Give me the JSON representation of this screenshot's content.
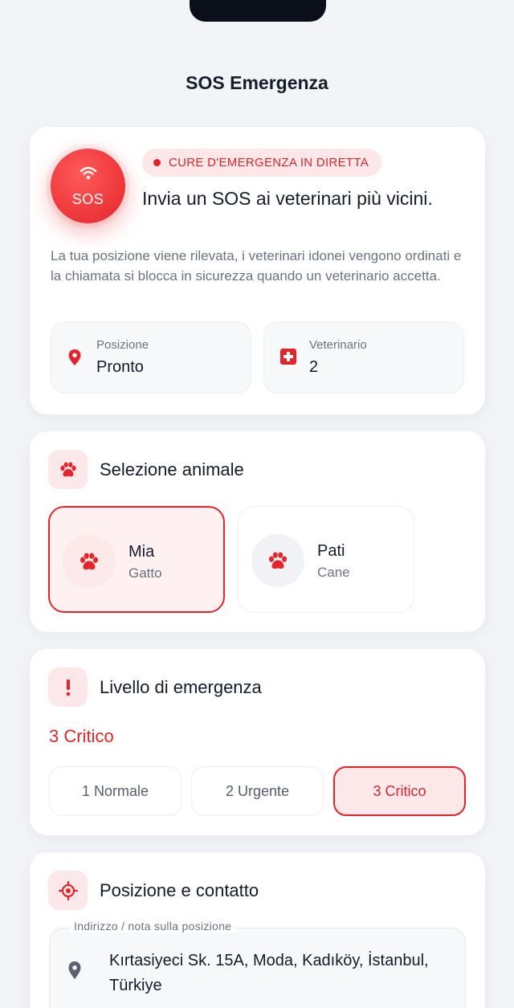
{
  "header": {
    "title": "SOS Emergenza"
  },
  "sos": {
    "button_label": "SOS",
    "badge": "CURE D'EMERGENZA IN DIRETTA",
    "headline": "Invia un SOS ai veterinari più vicini.",
    "description": "La tua posizione viene rilevata, i veterinari idonei vengono ordinati e la chiamata si blocca in sicurezza quando un veterinario accetta.",
    "stats": [
      {
        "label": "Posizione",
        "value": "Pronto",
        "icon": "location-pin-icon"
      },
      {
        "label": "Veterinario",
        "value": "2",
        "icon": "medical-cross-icon"
      }
    ]
  },
  "pets": {
    "title": "Selezione animale",
    "items": [
      {
        "name": "Mia",
        "kind": "Gatto",
        "selected": true
      },
      {
        "name": "Pati",
        "kind": "Cane",
        "selected": false
      }
    ]
  },
  "level": {
    "title": "Livello di emergenza",
    "current": "3 Critico",
    "options": [
      {
        "label": "1 Normale",
        "active": false
      },
      {
        "label": "2 Urgente",
        "active": false
      },
      {
        "label": "3 Critico",
        "active": true
      }
    ]
  },
  "location": {
    "title": "Posizione e contatto",
    "field_label": "Indirizzo / nota sulla posizione",
    "field_value": "Kırtasiyeci Sk. 15A, Moda, Kadıköy, İstanbul, Türkiye"
  },
  "colors": {
    "accent": "#e4242a",
    "accent_soft": "#fde8e9",
    "background": "#f3f4f7",
    "text": "#141b2d",
    "muted": "#6b7280"
  }
}
